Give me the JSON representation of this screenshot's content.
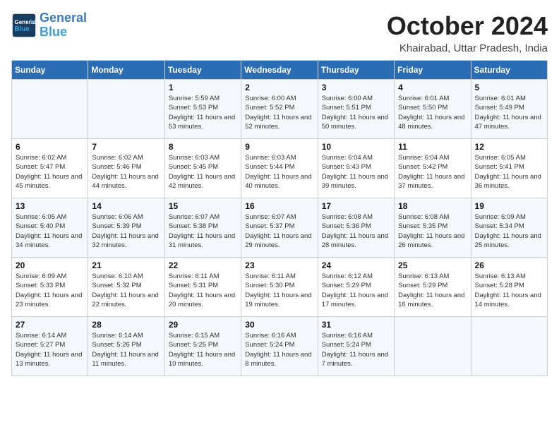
{
  "header": {
    "logo_line1": "General",
    "logo_line2": "Blue",
    "month": "October 2024",
    "location": "Khairabad, Uttar Pradesh, India"
  },
  "days_of_week": [
    "Sunday",
    "Monday",
    "Tuesday",
    "Wednesday",
    "Thursday",
    "Friday",
    "Saturday"
  ],
  "weeks": [
    [
      {
        "day": "",
        "info": ""
      },
      {
        "day": "",
        "info": ""
      },
      {
        "day": "1",
        "info": "Sunrise: 5:59 AM\nSunset: 5:53 PM\nDaylight: 11 hours and 53 minutes."
      },
      {
        "day": "2",
        "info": "Sunrise: 6:00 AM\nSunset: 5:52 PM\nDaylight: 11 hours and 52 minutes."
      },
      {
        "day": "3",
        "info": "Sunrise: 6:00 AM\nSunset: 5:51 PM\nDaylight: 11 hours and 50 minutes."
      },
      {
        "day": "4",
        "info": "Sunrise: 6:01 AM\nSunset: 5:50 PM\nDaylight: 11 hours and 48 minutes."
      },
      {
        "day": "5",
        "info": "Sunrise: 6:01 AM\nSunset: 5:49 PM\nDaylight: 11 hours and 47 minutes."
      }
    ],
    [
      {
        "day": "6",
        "info": "Sunrise: 6:02 AM\nSunset: 5:47 PM\nDaylight: 11 hours and 45 minutes."
      },
      {
        "day": "7",
        "info": "Sunrise: 6:02 AM\nSunset: 5:46 PM\nDaylight: 11 hours and 44 minutes."
      },
      {
        "day": "8",
        "info": "Sunrise: 6:03 AM\nSunset: 5:45 PM\nDaylight: 11 hours and 42 minutes."
      },
      {
        "day": "9",
        "info": "Sunrise: 6:03 AM\nSunset: 5:44 PM\nDaylight: 11 hours and 40 minutes."
      },
      {
        "day": "10",
        "info": "Sunrise: 6:04 AM\nSunset: 5:43 PM\nDaylight: 11 hours and 39 minutes."
      },
      {
        "day": "11",
        "info": "Sunrise: 6:04 AM\nSunset: 5:42 PM\nDaylight: 11 hours and 37 minutes."
      },
      {
        "day": "12",
        "info": "Sunrise: 6:05 AM\nSunset: 5:41 PM\nDaylight: 11 hours and 36 minutes."
      }
    ],
    [
      {
        "day": "13",
        "info": "Sunrise: 6:05 AM\nSunset: 5:40 PM\nDaylight: 11 hours and 34 minutes."
      },
      {
        "day": "14",
        "info": "Sunrise: 6:06 AM\nSunset: 5:39 PM\nDaylight: 11 hours and 32 minutes."
      },
      {
        "day": "15",
        "info": "Sunrise: 6:07 AM\nSunset: 5:38 PM\nDaylight: 11 hours and 31 minutes."
      },
      {
        "day": "16",
        "info": "Sunrise: 6:07 AM\nSunset: 5:37 PM\nDaylight: 11 hours and 29 minutes."
      },
      {
        "day": "17",
        "info": "Sunrise: 6:08 AM\nSunset: 5:36 PM\nDaylight: 11 hours and 28 minutes."
      },
      {
        "day": "18",
        "info": "Sunrise: 6:08 AM\nSunset: 5:35 PM\nDaylight: 11 hours and 26 minutes."
      },
      {
        "day": "19",
        "info": "Sunrise: 6:09 AM\nSunset: 5:34 PM\nDaylight: 11 hours and 25 minutes."
      }
    ],
    [
      {
        "day": "20",
        "info": "Sunrise: 6:09 AM\nSunset: 5:33 PM\nDaylight: 11 hours and 23 minutes."
      },
      {
        "day": "21",
        "info": "Sunrise: 6:10 AM\nSunset: 5:32 PM\nDaylight: 11 hours and 22 minutes."
      },
      {
        "day": "22",
        "info": "Sunrise: 6:11 AM\nSunset: 5:31 PM\nDaylight: 11 hours and 20 minutes."
      },
      {
        "day": "23",
        "info": "Sunrise: 6:11 AM\nSunset: 5:30 PM\nDaylight: 11 hours and 19 minutes."
      },
      {
        "day": "24",
        "info": "Sunrise: 6:12 AM\nSunset: 5:29 PM\nDaylight: 11 hours and 17 minutes."
      },
      {
        "day": "25",
        "info": "Sunrise: 6:13 AM\nSunset: 5:29 PM\nDaylight: 11 hours and 16 minutes."
      },
      {
        "day": "26",
        "info": "Sunrise: 6:13 AM\nSunset: 5:28 PM\nDaylight: 11 hours and 14 minutes."
      }
    ],
    [
      {
        "day": "27",
        "info": "Sunrise: 6:14 AM\nSunset: 5:27 PM\nDaylight: 11 hours and 13 minutes."
      },
      {
        "day": "28",
        "info": "Sunrise: 6:14 AM\nSunset: 5:26 PM\nDaylight: 11 hours and 11 minutes."
      },
      {
        "day": "29",
        "info": "Sunrise: 6:15 AM\nSunset: 5:25 PM\nDaylight: 11 hours and 10 minutes."
      },
      {
        "day": "30",
        "info": "Sunrise: 6:16 AM\nSunset: 5:24 PM\nDaylight: 11 hours and 8 minutes."
      },
      {
        "day": "31",
        "info": "Sunrise: 6:16 AM\nSunset: 5:24 PM\nDaylight: 11 hours and 7 minutes."
      },
      {
        "day": "",
        "info": ""
      },
      {
        "day": "",
        "info": ""
      }
    ]
  ]
}
